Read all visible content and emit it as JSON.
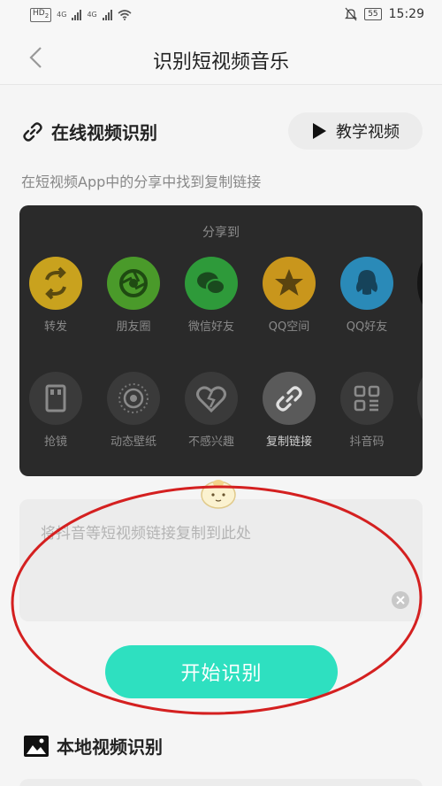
{
  "status_bar": {
    "hd_label": "HD",
    "hd_sub": "2",
    "sim1_label": "4G",
    "sim2_label": "4G",
    "battery": "55",
    "time": "15:29"
  },
  "header": {
    "title": "识别短视频音乐"
  },
  "online": {
    "title": "在线视频识别",
    "tutorial_label": "教学视频",
    "hint": "在短视频App中的分享中找到复制链接"
  },
  "share_sheet": {
    "title": "分享到",
    "row1": [
      {
        "label": "转发",
        "color": "#c9a21e",
        "icon": "repost-icon"
      },
      {
        "label": "朋友圈",
        "color": "#4a9a2a",
        "icon": "moments-icon"
      },
      {
        "label": "微信好友",
        "color": "#2e9a3a",
        "icon": "wechat-icon"
      },
      {
        "label": "QQ空间",
        "color": "#c9961c",
        "icon": "qzone-icon"
      },
      {
        "label": "QQ好友",
        "color": "#2a8ab8",
        "icon": "qq-icon"
      }
    ],
    "row2": [
      {
        "label": "抢镜",
        "color": "#3a3a3a",
        "icon": "frame-icon"
      },
      {
        "label": "动态壁纸",
        "color": "#3a3a3a",
        "icon": "wallpaper-icon"
      },
      {
        "label": "不感兴趣",
        "color": "#3a3a3a",
        "icon": "broken-heart-icon"
      },
      {
        "label": "复制链接",
        "color": "#5a5a5a",
        "icon": "link-icon"
      },
      {
        "label": "抖音码",
        "color": "#3a3a3a",
        "icon": "qr-code-icon"
      }
    ]
  },
  "input": {
    "placeholder": "将抖音等短视频链接复制到此处",
    "value": ""
  },
  "actions": {
    "start_label": "开始识别"
  },
  "local": {
    "title": "本地视频识别"
  },
  "colors": {
    "accent": "#2ee0c0",
    "annotation": "#d42020"
  }
}
